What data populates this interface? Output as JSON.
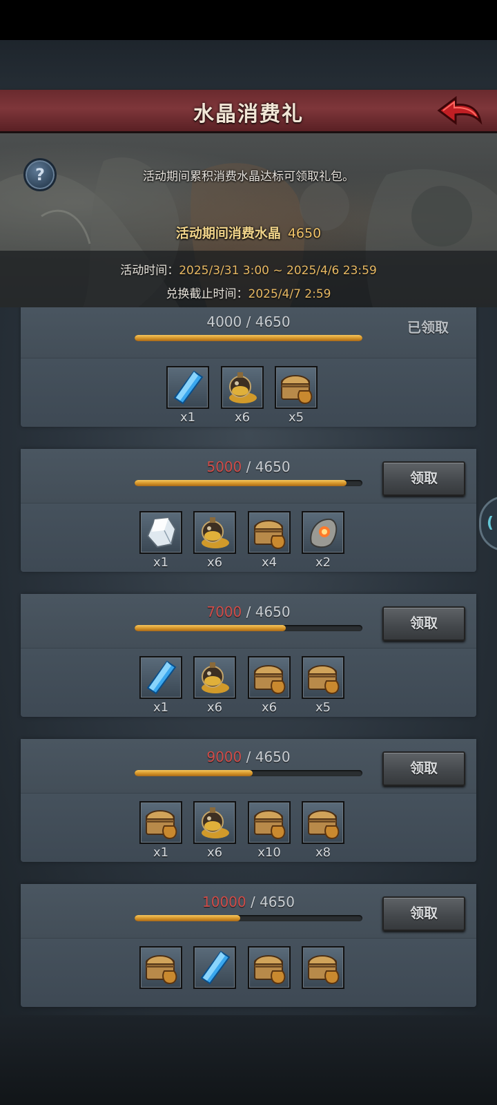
{
  "header": {
    "title": "水晶消费礼"
  },
  "info": {
    "description": "活动期间累积消费水晶达标可领取礼包。",
    "consumed_label": "活动期间消费水晶",
    "consumed_value": "4650",
    "activity_time_label": "活动时间：",
    "activity_time_value": "2025/3/31 3:00 ~ 2025/4/6 23:59",
    "deadline_label": "兑换截止时间：",
    "deadline_value": "2025/4/7 2:59"
  },
  "labels": {
    "claimed": "已领取",
    "claim": "领取"
  },
  "tiers": [
    {
      "required": "4000",
      "current": "4650",
      "progress": 1.0,
      "status": "claimed",
      "items": [
        {
          "icon": "blue-crystal",
          "qty": "x1"
        },
        {
          "icon": "gold-potion",
          "qty": "x6"
        },
        {
          "icon": "treasure-chest",
          "qty": "x5"
        }
      ]
    },
    {
      "required": "5000",
      "current": "4650",
      "progress": 0.93,
      "status": "claim",
      "items": [
        {
          "icon": "white-crystal",
          "qty": "x1"
        },
        {
          "icon": "gold-potion",
          "qty": "x6"
        },
        {
          "icon": "treasure-chest",
          "qty": "x4"
        },
        {
          "icon": "fire-stone",
          "qty": "x2"
        }
      ]
    },
    {
      "required": "7000",
      "current": "4650",
      "progress": 0.664,
      "status": "claim",
      "items": [
        {
          "icon": "blue-crystal",
          "qty": "x1"
        },
        {
          "icon": "gold-potion",
          "qty": "x6"
        },
        {
          "icon": "treasure-chest",
          "qty": "x6"
        },
        {
          "icon": "treasure-chest",
          "qty": "x5"
        }
      ]
    },
    {
      "required": "9000",
      "current": "4650",
      "progress": 0.517,
      "status": "claim",
      "items": [
        {
          "icon": "treasure-chest",
          "qty": "x1"
        },
        {
          "icon": "gold-potion",
          "qty": "x6"
        },
        {
          "icon": "treasure-chest",
          "qty": "x10"
        },
        {
          "icon": "treasure-chest",
          "qty": "x8"
        }
      ]
    },
    {
      "required": "10000",
      "current": "4650",
      "progress": 0.465,
      "status": "claim",
      "items": [
        {
          "icon": "treasure-chest",
          "qty": ""
        },
        {
          "icon": "blue-crystal",
          "qty": ""
        },
        {
          "icon": "treasure-chest",
          "qty": ""
        },
        {
          "icon": "treasure-chest",
          "qty": ""
        }
      ]
    }
  ],
  "colors": {
    "accent_gold": "#e8b963",
    "need_red": "#d04d4a",
    "title_red": "#7e363a"
  }
}
